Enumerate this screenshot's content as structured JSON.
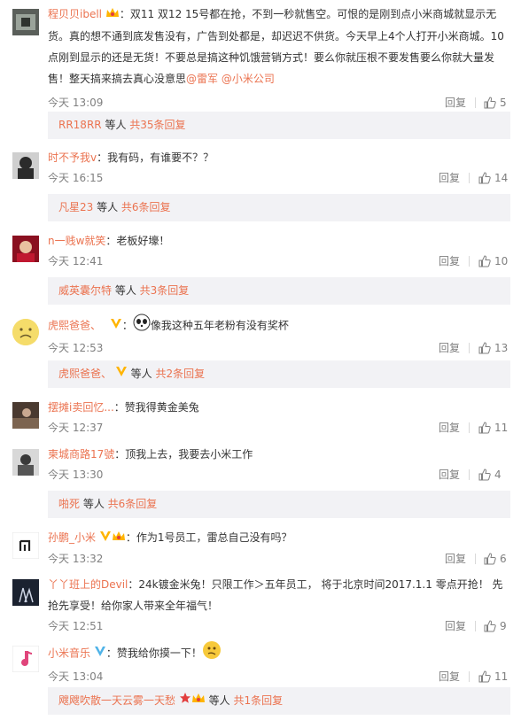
{
  "comments": [
    {
      "user": "程贝贝ibell",
      "text": "：双11 双12 15号都在抢，不到一秒就售空。可恨的是刚到点小米商城就显示无货。真的想不通到底发售没有，广告到处都是，却迟迟不供货。今天早上4个人打开小米商城。10点刚到显示的还是无货！不要总是搞这种饥饿营销方式！要么你就压根不要发售要么你就大量发售！整天搞来搞去真心没意思",
      "mention1": "@雷军",
      "mention2": "@小米公司",
      "time": "今天 13:09",
      "reply": "回复",
      "likes": "5",
      "sub": {
        "users": "RR18RR",
        "mid": " 等人 ",
        "count": "共35条回复"
      }
    },
    {
      "user": "时不予我v",
      "text": "：我有码，有谁要不？？",
      "time": "今天 16:15",
      "reply": "回复",
      "likes": "14",
      "sub": {
        "users": "凡星23",
        "mid": " 等人 ",
        "count": "共6条回复"
      }
    },
    {
      "user": "n一贱w就笑",
      "text": "：老板好壕！",
      "time": "今天 12:41",
      "reply": "回复",
      "likes": "10",
      "sub": {
        "users": "威英囊尔特",
        "mid": " 等人 ",
        "count": "共3条回复"
      }
    },
    {
      "user": "虎熙爸爸、",
      "text": "像我这种五年老粉有没有奖杯",
      "time": "今天 12:53",
      "reply": "回复",
      "likes": "13",
      "sub": {
        "users": "虎熙爸爸、",
        "mid": " 等人 ",
        "count": "共2条回复"
      }
    },
    {
      "user": "摆摊i卖回忆...",
      "text": "：赞我得黄金美兔",
      "time": "今天 12:37",
      "reply": "回复",
      "likes": "11"
    },
    {
      "user": "柬城商路17號",
      "text": "：顶我上去，我要去小米工作",
      "time": "今天 13:30",
      "reply": "回复",
      "likes": "4",
      "sub": {
        "users": "啪死",
        "mid": " 等人 ",
        "count": "共6条回复"
      }
    },
    {
      "user": "孙鹏_小米",
      "text": "：作为1号员工，雷总自己没有吗？",
      "time": "今天 13:32",
      "reply": "回复",
      "likes": "6"
    },
    {
      "user": "丫丫班上的Devil",
      "text": "：24k镀金米兔！只限工作＞五年员工， 将于北京时间2017.1.1 零点开抢！ 先抢先享受！给你家人带来全年福气！",
      "time": "今天 12:51",
      "reply": "回复",
      "likes": "9"
    },
    {
      "user": "小米音乐",
      "text": "：赞我给你摸一下！",
      "time": "今天 13:04",
      "reply": "回复",
      "likes": "11",
      "sub": {
        "users": "飕飕吹散一天云雾一天愁",
        "mid": " 等人 ",
        "count": "共1条回复"
      }
    }
  ],
  "colors": {
    "link": "#eb7350",
    "text": "#333333",
    "meta": "#808080",
    "subbg": "#f2f2f5",
    "vip": "#ffb400"
  }
}
